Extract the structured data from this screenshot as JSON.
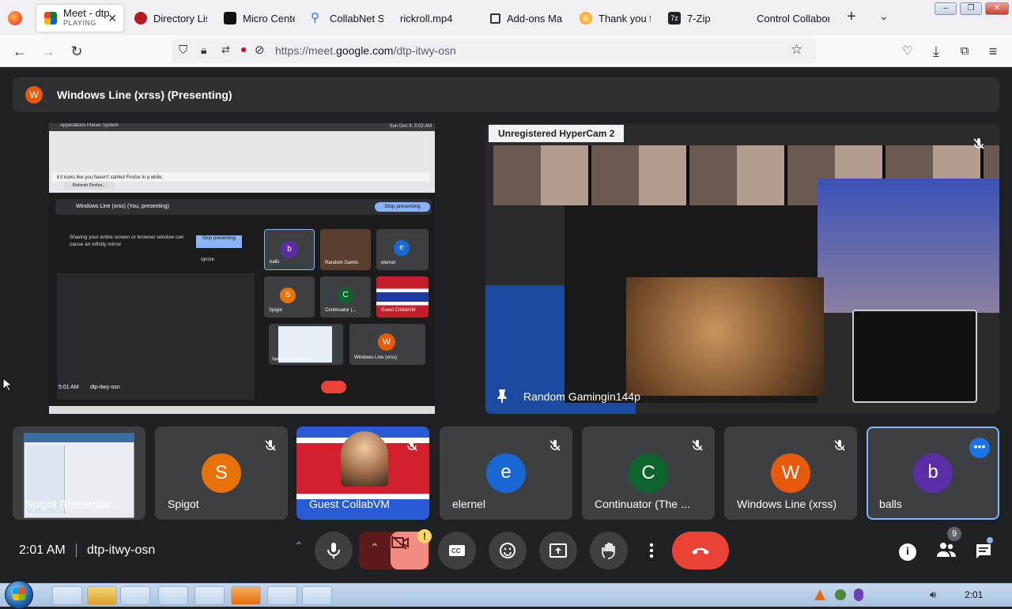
{
  "browser": {
    "tabs": [
      {
        "label": "Meet - dtp",
        "sub": "PLAYING",
        "active": true,
        "icon": "google-meet-icon"
      },
      {
        "label": "Directory List",
        "icon": "directory-icon"
      },
      {
        "label": "Micro Center",
        "icon": "microcenter-icon"
      },
      {
        "label": "CollabNet Se",
        "icon": "search-icon"
      },
      {
        "label": "rickroll.mp4",
        "icon": "video-icon"
      },
      {
        "label": "Add-ons Mar",
        "icon": "puzzle-icon"
      },
      {
        "label": "Thank you fo",
        "icon": "firefox-icon"
      },
      {
        "label": "7-Zip",
        "icon": "7zip-icon"
      },
      {
        "label": "Control Collabor",
        "icon": "none"
      }
    ],
    "url": {
      "prefix": "https://meet.",
      "domain": "google.com",
      "path": "/dtp-itwy-osn"
    }
  },
  "meet": {
    "presenter_banner": {
      "initial": "W",
      "label": "Windows Line (xrss) (Presenting)",
      "avatar_color": "#e8590c"
    },
    "pinned_tile": {
      "label": "Random Gamingin144p",
      "hypercam_text": "Unregistered HyperCam 2",
      "icon": "pin-icon"
    },
    "participants": [
      {
        "name": "Spigot (Presentat...",
        "initial": "",
        "color": "#3c4043",
        "muted": false
      },
      {
        "name": "Spigot",
        "initial": "S",
        "color": "#e8710a",
        "muted": true
      },
      {
        "name": "Guest CollabVM",
        "initial": "",
        "color": "#3c4043",
        "muted": true
      },
      {
        "name": "elernel",
        "initial": "e",
        "color": "#1967d2",
        "muted": true
      },
      {
        "name": "Continuator (The ...",
        "initial": "C",
        "color": "#0d652d",
        "muted": true
      },
      {
        "name": "Windows Line (xrss)",
        "initial": "W",
        "color": "#e8590c",
        "muted": true
      },
      {
        "name": "balls",
        "initial": "b",
        "color": "#5b2ea8",
        "muted": false
      }
    ],
    "meeting_time": "2:01 AM",
    "meeting_code": "dtp-itwy-osn",
    "participant_count": "9",
    "camera_alert": "!"
  },
  "presented_screen": {
    "top_bar": "Applications   Places   System",
    "clock": "Sun Dec 8, 5:02 AM",
    "presenting_label": "Windows Line (xrss) (You, presenting)",
    "stop_button": "Stop presenting",
    "infinity_text": "Sharing your entire screen or browser window can cause an infinity mirror",
    "stop_small": "Stop presenting",
    "ignore": "Ignore",
    "refresh": "Refresh Firefox...",
    "mini_time": "5:01 AM",
    "mini_code": "dtp-itwy-osn",
    "mini_names": [
      "balls",
      "Random Gamin",
      "elernel",
      "Spigot",
      "Continuator (...",
      "Guest CollabVM",
      "Spigot (Presentation)",
      "Windows Line (xrss)"
    ],
    "mini_initials": [
      "b",
      "e",
      "S",
      "C",
      "W"
    ]
  },
  "taskbar": {
    "clock": "2:01"
  }
}
